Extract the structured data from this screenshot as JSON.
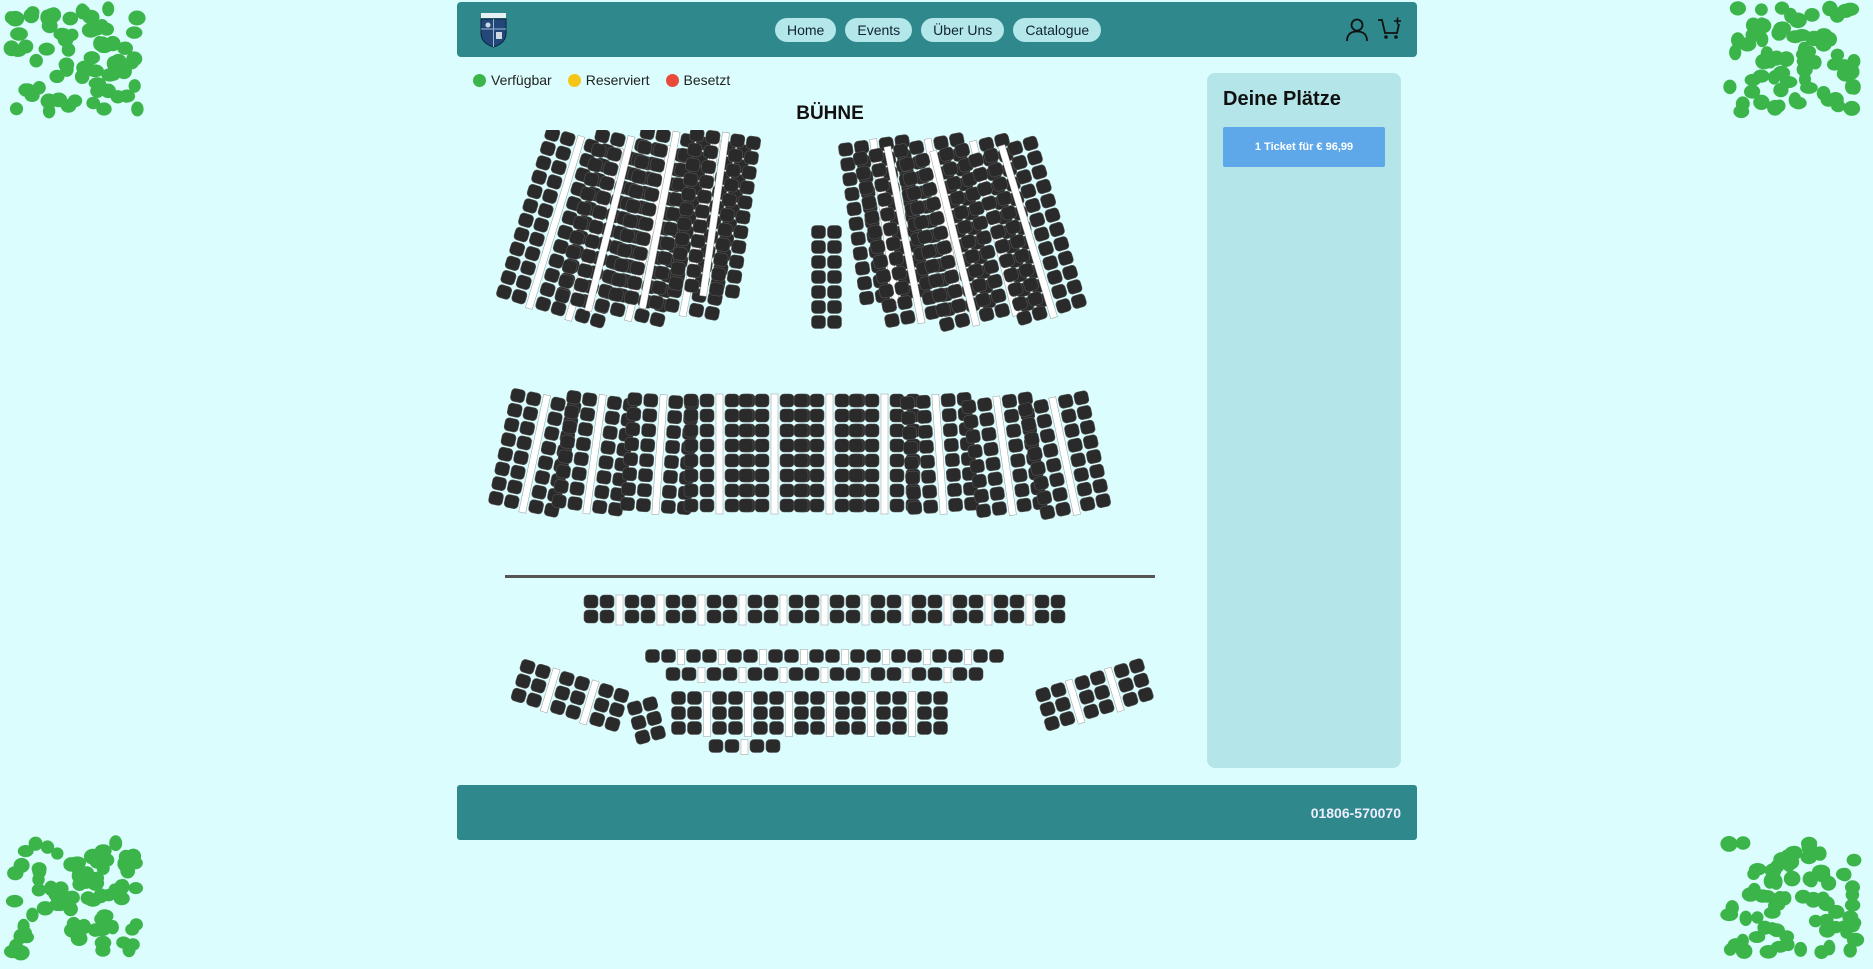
{
  "nav": {
    "home_label": "Home",
    "events_label": "Events",
    "about_label": "Über Uns",
    "catalogue_label": "Catalogue"
  },
  "header_icons": [
    "user-icon",
    "cart-add-icon"
  ],
  "legend": {
    "available_label": "Verfügbar",
    "available_color": "#3bb54a",
    "reserved_label": "Reserviert",
    "reserved_color": "#f5c518",
    "occupied_label": "Besetzt",
    "occupied_color": "#e84a3c"
  },
  "stage_label": "BÜHNE",
  "seat_color": "#2a2a2a",
  "panel": {
    "title": "Deine Plätze",
    "ticket_button_label": "1 Ticket für € 96,99"
  },
  "footer": {
    "phone": "01806-570070"
  },
  "colors": {
    "header_bg": "#2e888c",
    "page_bg": "#dcfdfe",
    "panel_bg": "#b4e5e8",
    "button_bg": "#5ea8ea",
    "decor_green": "#3bb54a"
  }
}
